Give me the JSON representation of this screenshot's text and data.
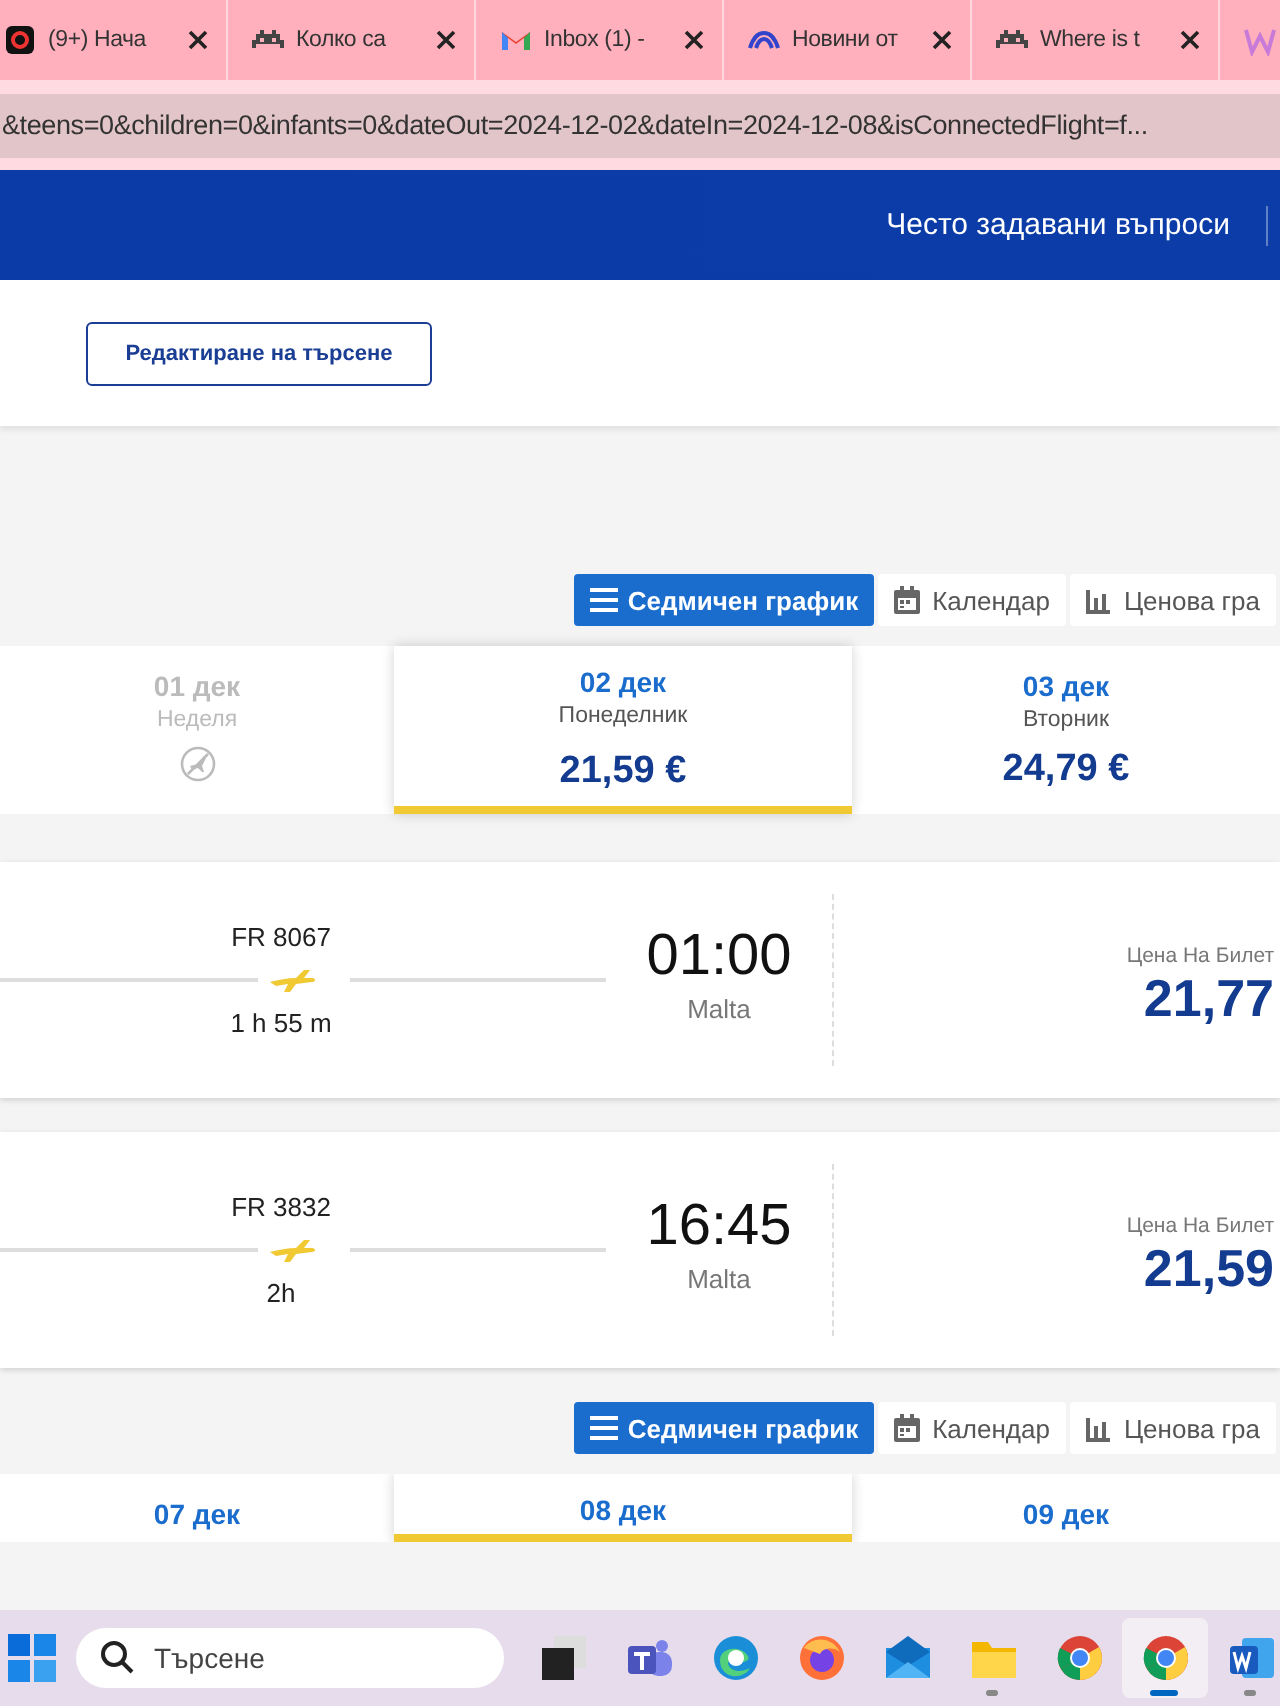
{
  "browser": {
    "tabs": [
      {
        "kind": "g",
        "label": "(9+) Нача"
      },
      {
        "kind": "invader",
        "label": "Колко са"
      },
      {
        "kind": "gmail",
        "label": "Inbox (1) -"
      },
      {
        "kind": "wave",
        "label": "Новини от"
      },
      {
        "kind": "invader",
        "label": "Where is t"
      },
      {
        "kind": "w"
      }
    ],
    "address": "&teens=0&children=0&infants=0&dateOut=2024-12-02&dateIn=2024-12-08&isConnectedFlight=f..."
  },
  "header": {
    "nav_link": "Често задавани въпроси"
  },
  "edit_search_button": "Редактиране на търсене",
  "sections": [
    {
      "view_tabs": [
        {
          "kind": "list",
          "label": "Седмичен график",
          "selected": true
        },
        {
          "kind": "calendar",
          "label": "Календар",
          "selected": false
        },
        {
          "kind": "bars",
          "label": "Ценова гра",
          "selected": false
        }
      ],
      "dates": [
        {
          "date": "01 дек",
          "weekday": "Неделя",
          "disabled": true,
          "selected": false
        },
        {
          "date": "02 дек",
          "weekday": "Понеделник",
          "price": "21,59 €",
          "disabled": false,
          "selected": true
        },
        {
          "date": "03 дек",
          "weekday": "Вторник",
          "price": "24,79 €",
          "disabled": false,
          "selected": false
        }
      ],
      "flights": [
        {
          "number": "FR 8067",
          "duration": "1 h 55 m",
          "arrival_time": "01:00",
          "arrival_city": "Malta",
          "price_label": "Цена На Билет",
          "price": "21,77"
        },
        {
          "number": "FR 3832",
          "duration": "2h",
          "arrival_time": "16:45",
          "arrival_city": "Malta",
          "price_label": "Цена На Билет",
          "price": "21,59"
        }
      ]
    },
    {
      "view_tabs": [
        {
          "kind": "list",
          "label": "Седмичен график",
          "selected": true
        },
        {
          "kind": "calendar",
          "label": "Календар",
          "selected": false
        },
        {
          "kind": "bars",
          "label": "Ценова гра",
          "selected": false
        }
      ],
      "dates": [
        {
          "date": "07 дек",
          "disabled": false,
          "selected": false
        },
        {
          "date": "08 дек",
          "disabled": false,
          "selected": true
        },
        {
          "date": "09 дек",
          "disabled": false,
          "selected": false
        }
      ]
    }
  ],
  "taskbar": {
    "search_placeholder": "Търсене",
    "apps": [
      {
        "kind": "taskview",
        "running": false,
        "selected": false
      },
      {
        "kind": "teams",
        "running": false,
        "selected": false
      },
      {
        "kind": "edge",
        "running": false,
        "selected": false
      },
      {
        "kind": "firefox",
        "running": false,
        "selected": false
      },
      {
        "kind": "mail",
        "running": false,
        "selected": false
      },
      {
        "kind": "folder",
        "running": true,
        "selected": false
      },
      {
        "kind": "chrome",
        "running": false,
        "selected": false
      },
      {
        "kind": "chrome",
        "running": true,
        "selected": true
      },
      {
        "kind": "word",
        "running": true,
        "selected": false
      }
    ]
  }
}
